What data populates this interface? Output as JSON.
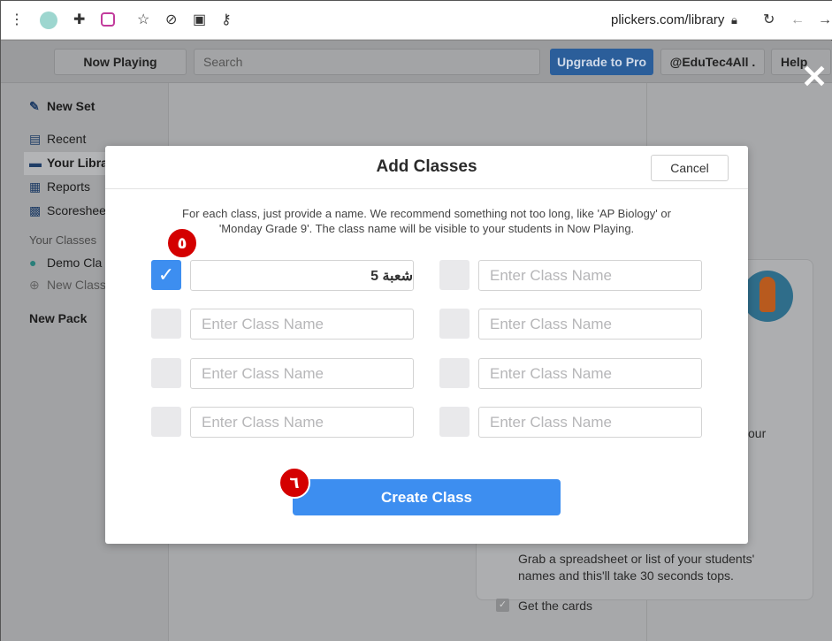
{
  "browser": {
    "url": "plickers.com/library",
    "icons": [
      "menu-dots-icon",
      "extension-icon",
      "puzzle-icon",
      "instagram-icon",
      "star-icon",
      "eye-off-icon",
      "cast-icon",
      "key-icon",
      "lock-icon",
      "reload-icon",
      "back-icon",
      "forward-icon"
    ]
  },
  "topbar": {
    "now_playing": "Now Playing",
    "search_placeholder": "Search",
    "upgrade": "Upgrade to Pro",
    "account": "@EduTec4All .",
    "help": "Help"
  },
  "sidebar": {
    "new_set": "New Set",
    "recent": "Recent",
    "your_library": "Your Libra",
    "reports": "Reports",
    "scoresheet": "Scoreshee",
    "your_classes_heading": "Your Classes",
    "demo_class": "Demo Cla",
    "new_class": "New Class",
    "new_pack": "New Pack"
  },
  "card": {
    "partial_text": "our",
    "body": "Grab a spreadsheet or list of your students' names and this'll take 30 seconds tops.",
    "body_line1": "Grab a spreadsheet or list of your students'",
    "body_line2": "names and this'll take 30 seconds tops.",
    "get_cards": "Get the cards"
  },
  "modal": {
    "title": "Add Classes",
    "cancel": "Cancel",
    "instructions_line1": "For each class, just provide a name. We recommend something not too long, like 'AP Biology' or",
    "instructions_line2": "'Monday Grade 9'. The class name will be visible to your students in Now Playing.",
    "placeholder": "Enter Class Name",
    "first_value": "شعبة 5",
    "create": "Create Class",
    "accent": "#3d8ef0"
  },
  "annotations": {
    "step5": "٥",
    "step6": "٦"
  }
}
